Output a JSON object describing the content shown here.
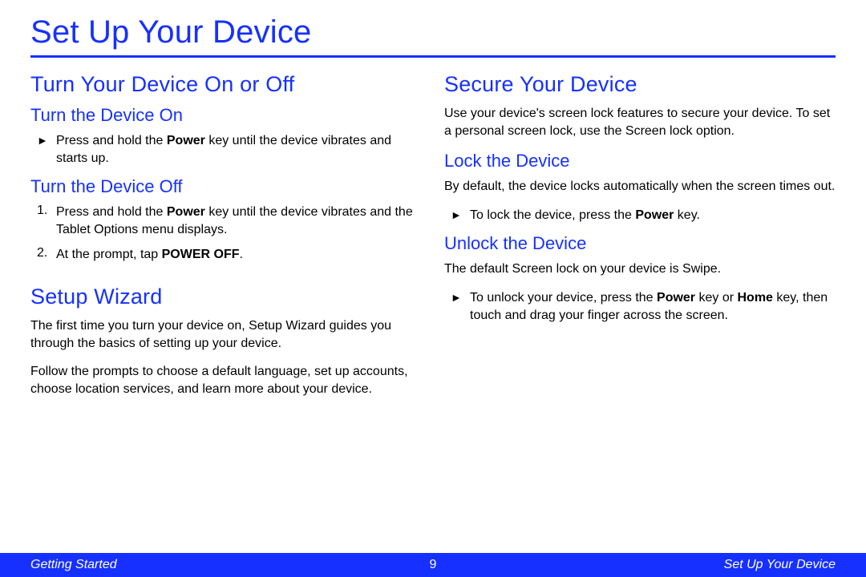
{
  "page_title": "Set Up Your Device",
  "left": {
    "h2a": "Turn Your Device On or Off",
    "h3a": "Turn the Device On",
    "bullet1_pre": "Press and hold the ",
    "bullet1_bold": "Power",
    "bullet1_post": " key until the device vibrates and starts up.",
    "h3b": "Turn the Device Off",
    "step1_pre": "Press and hold the ",
    "step1_bold": "Power",
    "step1_post": " key until the device vibrates and the Tablet Options menu displays.",
    "step2_pre": "At the prompt, tap ",
    "step2_bold": "POWER OFF",
    "step2_post": ".",
    "h2b": "Setup Wizard",
    "p1": "The first time you turn your device on, Setup Wizard guides you through the basics of setting up your device.",
    "p2": "Follow the prompts to choose a default language, set up accounts, choose location services, and learn more about your device."
  },
  "right": {
    "h2": "Secure Your Device",
    "p1": "Use your device's screen lock features to secure your device. To set a personal screen lock, use the Screen lock option.",
    "h3a": "Lock the Device",
    "p2": "By default, the device locks automatically when the screen times out.",
    "bullet1_pre": "To lock the device, press the ",
    "bullet1_bold": "Power",
    "bullet1_post": " key.",
    "h3b": "Unlock the Device",
    "p3": "The default Screen lock on your device is Swipe.",
    "bullet2_pre": "To unlock your device, press the ",
    "bullet2_bold1": "Power",
    "bullet2_mid": " key or ",
    "bullet2_bold2": "Home",
    "bullet2_post": " key, then touch and drag your finger across the screen."
  },
  "footer": {
    "left": "Getting Started",
    "page_num": "9",
    "right": "Set Up Your Device"
  },
  "bullet_mark": "►",
  "num1": "1.",
  "num2": "2."
}
